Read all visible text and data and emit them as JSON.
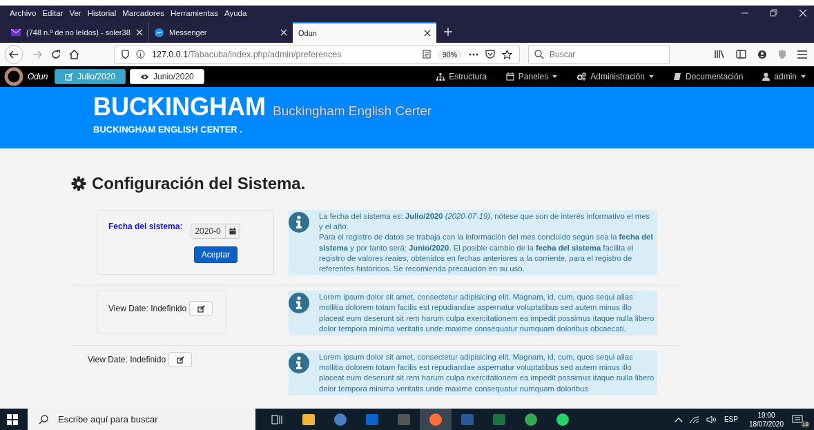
{
  "browser": {
    "menu": [
      "Archivo",
      "Editar",
      "Ver",
      "Historial",
      "Marcadores",
      "Herramientas",
      "Ayuda"
    ],
    "tabs": [
      {
        "title": "(748 n.º de no leídos) - soler38",
        "kind": "mail",
        "selected": false
      },
      {
        "title": "Messenger",
        "kind": "messenger",
        "selected": false
      },
      {
        "title": "Odun",
        "kind": "plain",
        "selected": true
      }
    ],
    "url_host": "127.0.0.1",
    "url_path": "/Tabacuba/index.php/admin/preferences",
    "zoom": "90%",
    "search_placeholder": "Buscar"
  },
  "navbar": {
    "brand": "Odun",
    "periods": [
      {
        "label": "Julio/2020",
        "kind": "edit",
        "selected": true
      },
      {
        "label": "Junio/2020",
        "kind": "view",
        "selected": false
      }
    ],
    "menu": [
      {
        "label": "Estructura",
        "kind": "sitemap",
        "dropdown": false
      },
      {
        "label": "Paneles",
        "kind": "calendar",
        "dropdown": true
      },
      {
        "label": "Administración",
        "kind": "gears",
        "dropdown": true
      },
      {
        "label": "Documentación",
        "kind": "book",
        "dropdown": false
      },
      {
        "label": "admin",
        "kind": "user",
        "dropdown": true
      }
    ]
  },
  "banner": {
    "title": "BUCKINGHAM",
    "subtitle": "Buckingham English Certer",
    "tagline": "BUCKINGHAM ENGLISH CENTER ."
  },
  "heading": "Configuración del Sistema.",
  "sections": [
    {
      "kind": "date_form",
      "label": "Fecha del sistema:",
      "value": "2020-0",
      "button": "Aceptar",
      "bordered": true,
      "info": [
        "La fecha del sistema es: **Julio/2020** *(2020-07-19)*, nótese que son de interés informativo el mes y el año.",
        "Para el registro de datos se trabaja con la información del mes concluido según sea la **fecha del sistema** y por tanto será: **Junio/2020**.  El posible cambio de la **fecha del sistema** facilita el registro de valores *reales*, obtenidos en fechas anteriores a la corriente, para el registro de referentes históricos. Se recomienda precaución en su uso."
      ]
    },
    {
      "kind": "view_date",
      "label": "View Date: Indefinido",
      "bordered": true,
      "info": [
        "Lorem ipsum dolor sit amet, consectetur adipisicing elit. Magnam, id, cum, quos sequi alias mollitia dolorem totam facilis est repudiandae aspernatur voluptatibus sed autem minus illo placeat eum deserunt sit rem harum culpa exercitationem ea impedit possimus itaque nulla libero dolor tempora minima veritatis unde maxime consequatur numquam doloribus obcaecati."
      ]
    },
    {
      "kind": "view_date",
      "label": "View Date: Indefinido",
      "bordered": false,
      "info": [
        "Lorem ipsum dolor sit amet, consectetur adipisicing elit. Magnam, id, cum, quos sequi alias mollitia dolorem totam facilis est repudiandae aspernatur voluptatibus sed autem minus illo placeat eum deserunt sit rem harum culpa exercitationem ea impedit possimus itaque nulla libero dolor tempora minima veritatis unde maxime consequatur numquam doloribus"
      ]
    }
  ],
  "taskbar": {
    "search_placeholder": "Escribe aquí para buscar",
    "apps": [
      {
        "kind": "taskview",
        "active": false
      },
      {
        "kind": "folder",
        "active": false
      },
      {
        "kind": "globe",
        "active": false
      },
      {
        "kind": "outlook",
        "active": false
      },
      {
        "kind": "calculator",
        "active": false
      },
      {
        "kind": "firefox",
        "active": true
      },
      {
        "kind": "word",
        "active": false
      },
      {
        "kind": "excel",
        "active": false
      },
      {
        "kind": "chrome",
        "active": false
      },
      {
        "kind": "whatsapp",
        "active": false
      }
    ],
    "language": "ESP",
    "time": "19:00",
    "date": "18/07/2020",
    "notifications": "18"
  }
}
